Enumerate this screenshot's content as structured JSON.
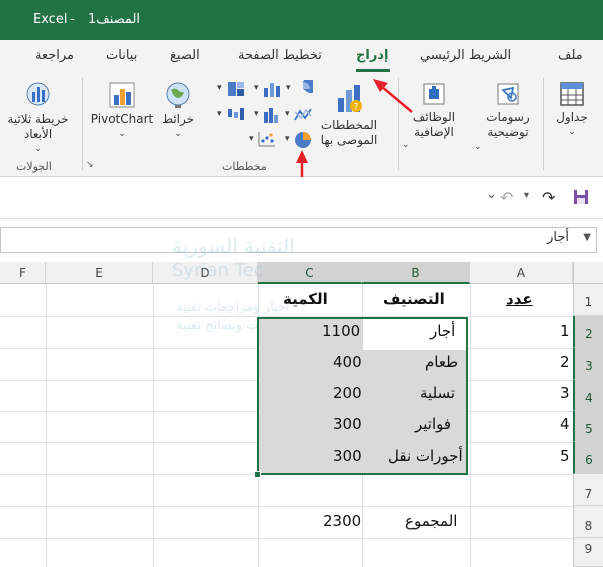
{
  "titlebar": {
    "document": "المصنف1",
    "separator": "-",
    "app": "Excel"
  },
  "tabs": [
    {
      "label": "ملف"
    },
    {
      "label": "الشريط الرئيسي"
    },
    {
      "label": "إدراج"
    },
    {
      "label": "تخطيط الصفحة"
    },
    {
      "label": "الصيغ"
    },
    {
      "label": "بيانات"
    },
    {
      "label": "مراجعة"
    }
  ],
  "ribbon": {
    "tables_label": "جداول",
    "illustrations_label": "رسومات توضيحية",
    "addins_label": "الوظائف الإضافية",
    "recommended_charts_label": "المخططات الموصى بها",
    "maps_label": "خرائط",
    "pivotchart_label": "PivotChart",
    "map3d_label": "خريطة ثلاثية الأبعاد",
    "group_charts": "مخططات",
    "group_tours": "الجولات"
  },
  "formula_bar": {
    "name_box": "أجار"
  },
  "watermark": {
    "line1": "التقنية السورية",
    "line2": "Syrian Tec",
    "line3": "أخبار ومراجعات تقنية",
    "line4": "شروحات ونصائح تقنية"
  },
  "grid": {
    "columns": [
      "A",
      "B",
      "C",
      "D",
      "E",
      "F"
    ],
    "rows": [
      "1",
      "2",
      "3",
      "4",
      "5",
      "6",
      "7",
      "8",
      "9"
    ],
    "headers": {
      "a": "عدد",
      "b": "التصنيف",
      "c": "الكمية"
    },
    "data": [
      {
        "a": "1",
        "b": "أجار",
        "c": "1100"
      },
      {
        "a": "2",
        "b": "طعام",
        "c": "400"
      },
      {
        "a": "3",
        "b": "تسلية",
        "c": "200"
      },
      {
        "a": "4",
        "b": "فواتير",
        "c": "300"
      },
      {
        "a": "5",
        "b": "أجورات نقل",
        "c": "300"
      }
    ],
    "total_label": "المجموع",
    "total_value": "2300"
  },
  "colors": {
    "accent": "#217346",
    "annotation": "#e8202a"
  }
}
